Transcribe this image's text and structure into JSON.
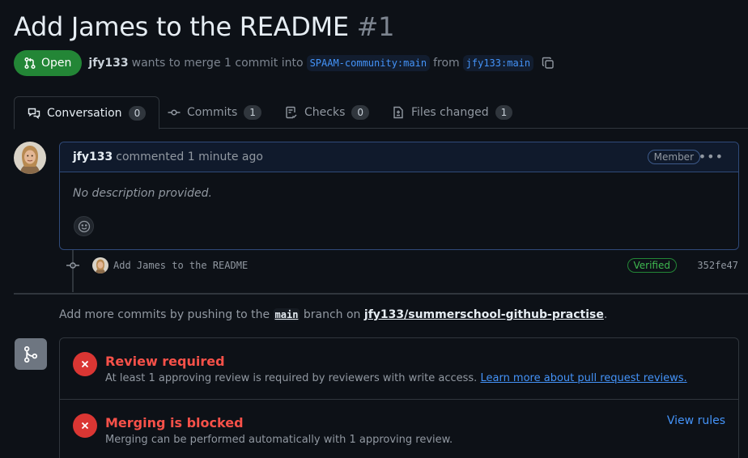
{
  "pr": {
    "title": "Add James to the README",
    "number": "#1",
    "state": "Open",
    "author": "jfy133",
    "merge_text_1": "wants to merge 1 commit into",
    "base_branch": "SPAAM-community:main",
    "merge_text_2": "from",
    "head_branch": "jfy133:main"
  },
  "tabs": [
    {
      "label": "Conversation",
      "count": "0"
    },
    {
      "label": "Commits",
      "count": "1"
    },
    {
      "label": "Checks",
      "count": "0"
    },
    {
      "label": "Files changed",
      "count": "1"
    }
  ],
  "comment": {
    "author": "jfy133",
    "action": "commented 1 minute ago",
    "role_badge": "Member",
    "more": "•••",
    "body": "No description provided."
  },
  "commit": {
    "message": "Add James to the README",
    "verified_label": "Verified",
    "sha": "352fe47"
  },
  "add_more": {
    "prefix": "Add more commits by pushing to the",
    "branch": "main",
    "middle": "branch on",
    "repo": "jfy133/summerschool-github-practise",
    "suffix": "."
  },
  "checks": [
    {
      "title": "Review required",
      "description": "At least 1 approving review is required by reviewers with write access.",
      "link": "Learn more about pull request reviews."
    },
    {
      "title": "Merging is blocked",
      "description": "Merging can be performed automatically with 1 approving review.",
      "action": "View rules"
    }
  ],
  "colors": {
    "background": "#0d1117",
    "open_green": "#238636",
    "danger_red": "#da3633",
    "link_blue": "#4493f8"
  },
  "icons": {
    "state": "git-pull-request-icon",
    "copy": "copy-icon",
    "tab_conversation": "comment-discussion-icon",
    "tab_commits": "git-commit-icon",
    "tab_checks": "checklist-icon",
    "tab_files": "file-diff-icon",
    "react": "smiley-icon",
    "merge": "git-merge-icon",
    "check_fail": "x-icon"
  }
}
